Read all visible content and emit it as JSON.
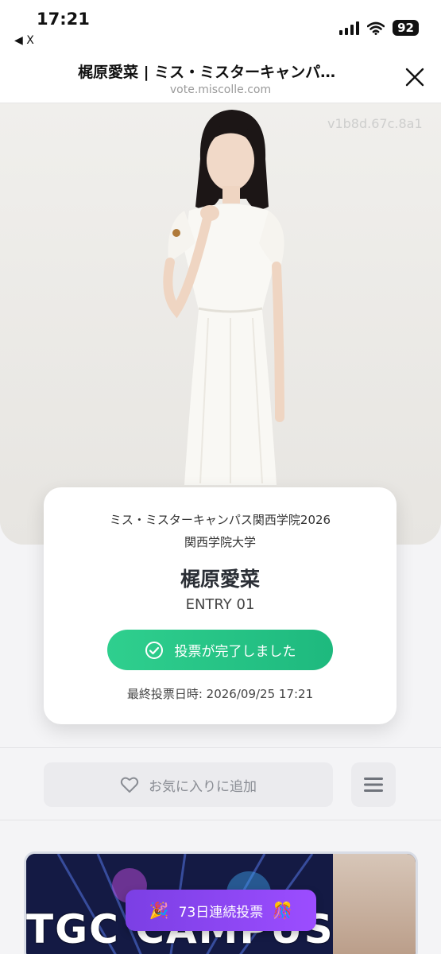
{
  "status_bar": {
    "time": "17:21",
    "back_app": "◀ X",
    "battery": "92"
  },
  "browser": {
    "title": "梶原愛菜 | ミス・ミスターキャンパ…",
    "url": "vote.miscolle.com"
  },
  "hero": {
    "watermark": "v1b8d.67c.8a1",
    "photo_icon": "portrait-photo-icon"
  },
  "profile": {
    "event": "ミス・ミスターキャンパス関西学院2026",
    "university": "関西学院大学",
    "name": "梶原愛菜",
    "entry": "ENTRY 01",
    "vote_status": "投票が完了しました",
    "last_vote": "最終投票日時: 2026/09/25 17:21"
  },
  "actions": {
    "favorite_label": "お気に入りに追加"
  },
  "banner": {
    "text": "TGC CAMPUS",
    "streak_label": "73日連続投票"
  },
  "colors": {
    "vote_green": "#22c184",
    "streak_purple": "#8a46f0",
    "card_bg": "#ffffff"
  }
}
